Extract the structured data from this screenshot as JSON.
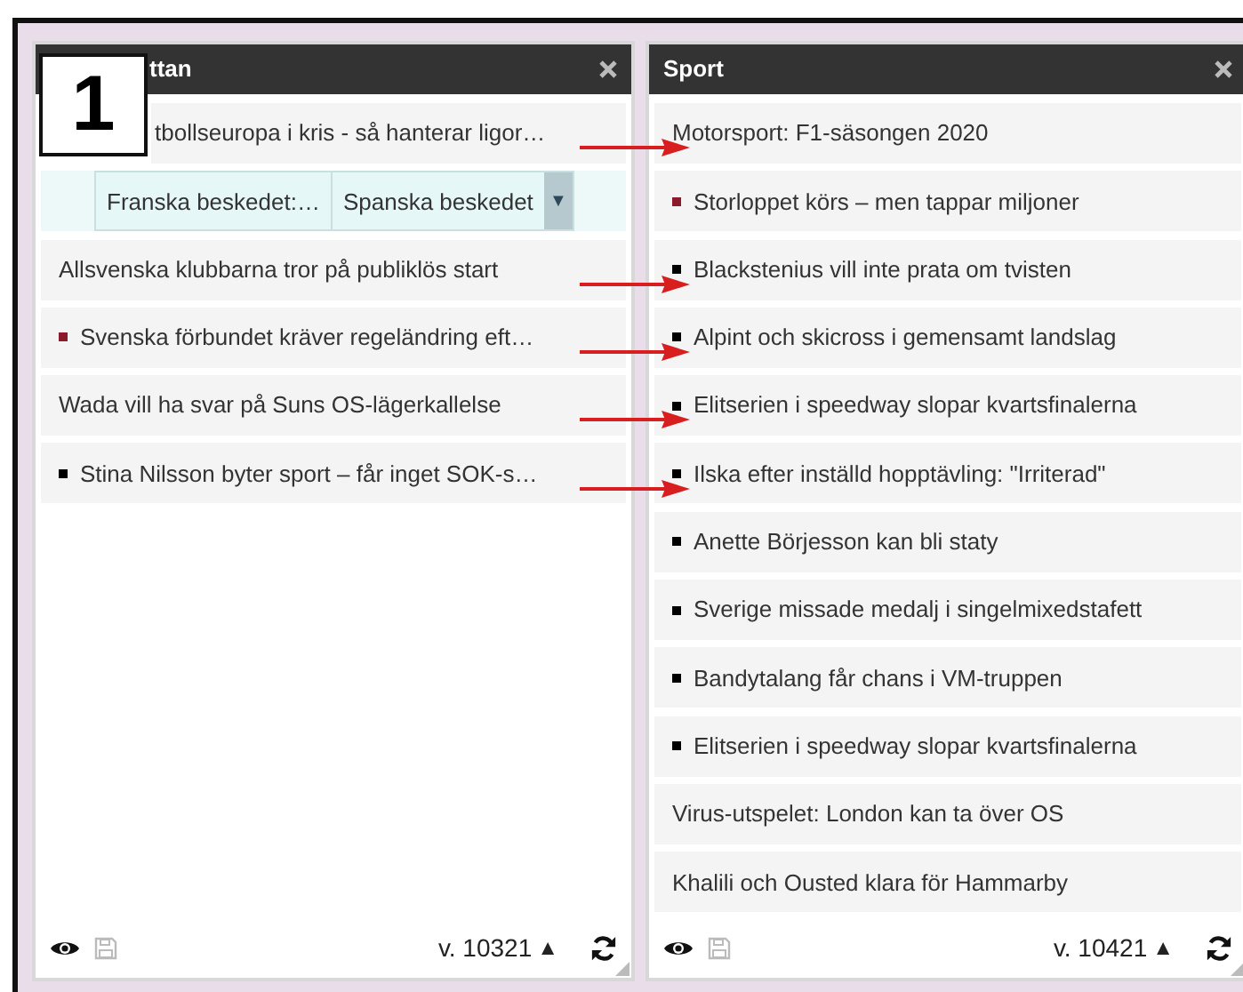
{
  "badge": "1",
  "panels": [
    {
      "title": "ttan",
      "rows": [
        {
          "kind": "item",
          "text": "tbollseuropa i kris - så hanterar ligor…",
          "arrow": true
        },
        {
          "kind": "split",
          "cells": [
            "Franska beskedet:…",
            "Spanska beskedet"
          ],
          "caret": "▼"
        },
        {
          "kind": "item",
          "text": "Allsvenska klubbarna tror på publiklös start",
          "arrow": true
        },
        {
          "kind": "item",
          "text": "Svenska förbundet kräver regeländring eft…",
          "color": "#8b1a2b",
          "arrow": true
        },
        {
          "kind": "item",
          "text": "Wada vill ha svar på Suns OS-lägerkallelse",
          "arrow": true
        },
        {
          "kind": "item",
          "text": "Stina Nilsson byter sport – får inget SOK-s…",
          "color": "#000000",
          "arrow": true
        }
      ],
      "version": "v. 10321",
      "version_caret": "▲"
    },
    {
      "title": "Sport",
      "rows": [
        {
          "kind": "item",
          "text": "Motorsport: F1-säsongen 2020",
          "arrow_target": true
        },
        {
          "kind": "item",
          "text": "Storloppet körs – men tappar miljoner",
          "color": "#8b1a2b"
        },
        {
          "kind": "item",
          "text": "Blackstenius vill inte prata om tvisten",
          "color": "#000000",
          "arrow_target": true
        },
        {
          "kind": "item",
          "text": "Alpint och skicross i gemensamt landslag",
          "color": "#000000",
          "arrow_target": true
        },
        {
          "kind": "item",
          "text": "Elitserien i speedway slopar kvartsfinalerna",
          "color": "#000000",
          "arrow_target": true
        },
        {
          "kind": "item",
          "text": "Ilska efter inställd hopptävling: \"Irriterad\"",
          "color": "#000000",
          "arrow_target": true
        },
        {
          "kind": "item",
          "text": "Anette Börjesson kan bli staty",
          "color": "#000000"
        },
        {
          "kind": "item",
          "text": "Sverige missade medalj i singelmixedstafett",
          "color": "#000000"
        },
        {
          "kind": "item",
          "text": "Bandytalang får chans i VM-truppen",
          "color": "#000000"
        },
        {
          "kind": "item",
          "text": "Elitserien i speedway slopar kvartsfinalerna",
          "color": "#000000"
        },
        {
          "kind": "item",
          "text": "Virus-utspelet: London kan ta över OS"
        },
        {
          "kind": "item",
          "text": "Khalili och Ousted klara för Hammarby"
        }
      ],
      "version": "v. 10421",
      "version_caret": "▲"
    }
  ]
}
